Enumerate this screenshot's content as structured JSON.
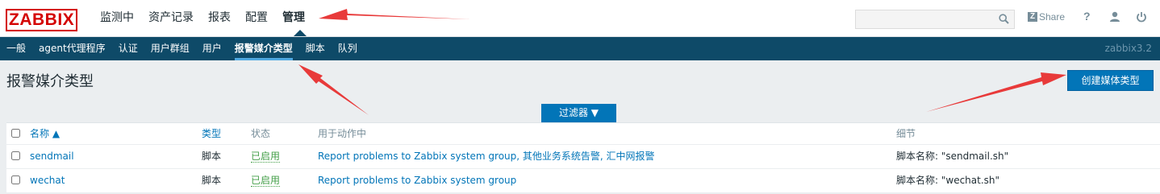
{
  "logo": "ZABBIX",
  "top_menu": [
    "监测中",
    "资产记录",
    "报表",
    "配置",
    "管理"
  ],
  "top_right": {
    "search_value": "",
    "share_label": "Share",
    "help_label": "?"
  },
  "sub_menu": [
    "一般",
    "agent代理程序",
    "认证",
    "用户群组",
    "用户",
    "报警媒介类型",
    "脚本",
    "队列"
  ],
  "version": "zabbix3.2",
  "page_title": "报警媒介类型",
  "create_button": "创建媒体类型",
  "filter_button": "过滤器 ▼",
  "table": {
    "headers": {
      "name": "名称 ▲",
      "type": "类型",
      "status": "状态",
      "used_in": "用于动作中",
      "details": "细节"
    },
    "rows": [
      {
        "name": "sendmail",
        "type": "脚本",
        "status": "已启用",
        "used_in": "Report problems to Zabbix system group, 其他业务系统告警, 汇中网报警",
        "details": "脚本名称: \"sendmail.sh\""
      },
      {
        "name": "wechat",
        "type": "脚本",
        "status": "已启用",
        "used_in": "Report problems to Zabbix system group",
        "details": "脚本名称: \"wechat.sh\""
      }
    ]
  },
  "colors": {
    "brand": "#d40000",
    "subnav": "#0e4a68",
    "button": "#0275b8",
    "link": "#0275b8",
    "enabled": "#429e47",
    "annotation_arrow": "#e83a3a"
  },
  "icons": [
    "search-icon",
    "share-icon",
    "help-icon",
    "user-icon",
    "power-icon",
    "sort-up-icon",
    "dropdown-arrow-icon"
  ]
}
